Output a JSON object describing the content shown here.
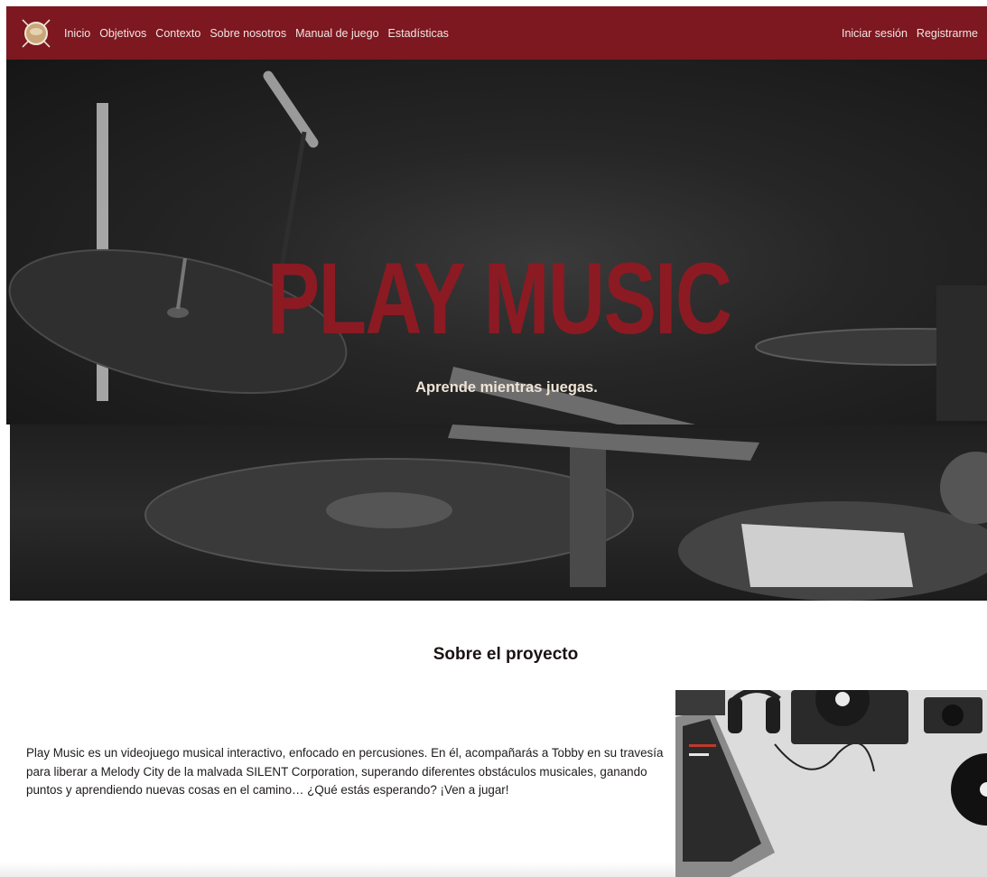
{
  "nav": {
    "logo_icon": "drum-logo-icon",
    "links": [
      "Inicio",
      "Objetivos",
      "Contexto",
      "Sobre nosotros",
      "Manual de juego",
      "Estadísticas"
    ],
    "login": "Iniciar sesión",
    "register": "Registrarme",
    "bar_color": "#7d1720"
  },
  "hero": {
    "title": "PLAY MUSIC",
    "subtitle": "Aprende mientras juegas.",
    "title_color": "#8c1a23",
    "background": "drum-kit-photo"
  },
  "about": {
    "heading": "Sobre el proyecto",
    "text": "Play Music es un videojuego musical interactivo, enfocado en percusiones. En él, acompañarás a Tobby en su travesía para liberar a Melody City de la malvada SILENT Corporation, superando diferentes obstáculos musicales, ganando puntos y aprendiendo nuevas cosas en el camino… ¿Qué estás esperando? ¡Ven a jugar!",
    "image": "desk-laptop-headphones-turntable-photo"
  }
}
